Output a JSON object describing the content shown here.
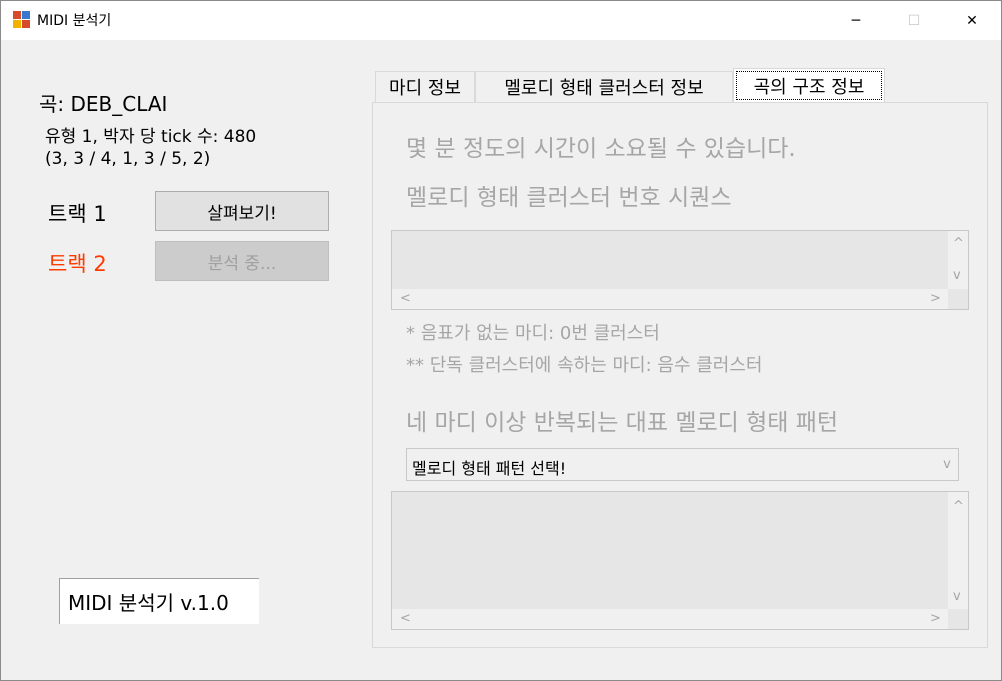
{
  "window": {
    "title": "MIDI 분석기",
    "controls": {
      "minimize": "─",
      "maximize": "☐",
      "close": "✕"
    }
  },
  "song": {
    "label": "곡: DEB_CLAI",
    "info_line1": "유형 1, 박자 당 tick 수: 480",
    "info_line2": "(3, 3 / 4, 1, 3 / 5, 2)"
  },
  "tracks": [
    {
      "label": "트랙 1",
      "color": "#000000",
      "button": "살펴보기!",
      "button_enabled": true
    },
    {
      "label": "트랙 2",
      "color": "#ff3b00",
      "button": "분석 중...",
      "button_enabled": false
    }
  ],
  "version": "MIDI 분석기 v.1.0",
  "tabs": [
    {
      "label": "마디 정보",
      "active": false
    },
    {
      "label": "멜로디 형태 클러스터 정보",
      "active": false
    },
    {
      "label": "곡의 구조 정보",
      "active": true
    }
  ],
  "panel": {
    "notice": "몇 분 정도의 시간이 소요될 수 있습니다.",
    "sequence_heading": "멜로디 형태 클러스터 번호 시퀀스",
    "footnote1": "* 음표가 없는 마디: 0번 클러스터",
    "footnote2": "** 단독 클러스터에 속하는 마디: 음수 클러스터",
    "pattern_heading": "네 마디 이상 반복되는 대표 멜로디 형태 패턴",
    "pattern_select": "멜로디 형태 패턴 선택!"
  },
  "icons": {
    "scroll_up": "^",
    "scroll_down": "v",
    "scroll_left": "<",
    "scroll_right": ">",
    "dropdown": "v"
  }
}
